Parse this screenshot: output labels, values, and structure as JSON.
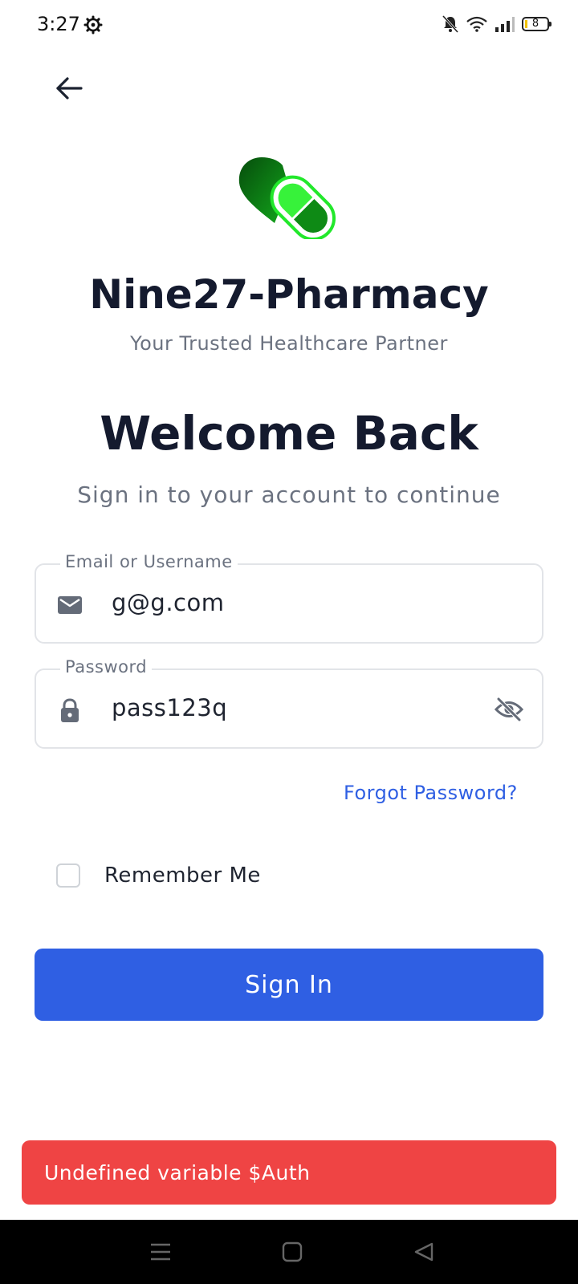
{
  "status_bar": {
    "time": "3:27",
    "battery_level": "8",
    "icons": [
      "settings-gear-icon",
      "bell-muted-icon",
      "wifi-icon",
      "cellular-signal-icon",
      "battery-icon"
    ]
  },
  "header": {
    "back_icon": "arrow-left-icon"
  },
  "brand": {
    "name": "Nine27-Pharmacy",
    "tagline": "Your Trusted Healthcare Partner",
    "logo_icon": "heart-pill-logo",
    "logo_colors": [
      "#0a7a12",
      "#35e83a"
    ]
  },
  "welcome": {
    "title": "Welcome Back",
    "subtitle": "Sign in to your account to continue"
  },
  "form": {
    "email": {
      "label": "Email or Username",
      "value": "g@g.com",
      "icon": "mail-icon"
    },
    "password": {
      "label": "Password",
      "value": "pass123q",
      "icon": "lock-icon",
      "toggle_icon": "eye-off-icon"
    },
    "forgot_label": "Forgot Password?",
    "remember_label": "Remember Me",
    "remember_checked": false,
    "submit_label": "Sign In"
  },
  "toast": {
    "message": "Undefined variable $Auth"
  },
  "colors": {
    "primary": "#2f5fe3",
    "error": "#ef4444",
    "text": "#141a2e",
    "muted": "#6b7280"
  },
  "nav_bar": {
    "icons": [
      "menu-icon",
      "home-square-icon",
      "back-triangle-icon"
    ]
  }
}
